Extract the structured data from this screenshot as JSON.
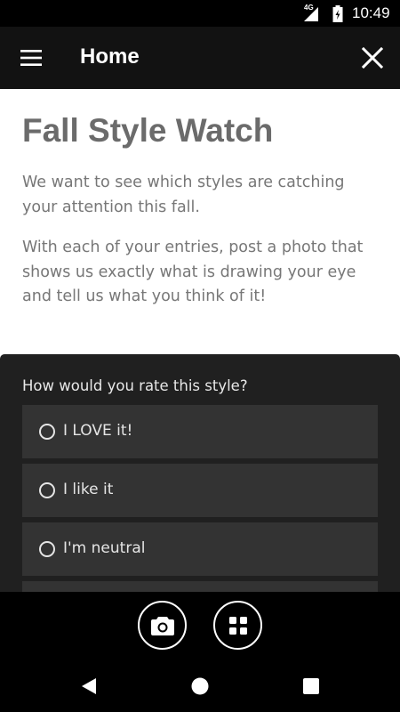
{
  "status_bar": {
    "network": "4G",
    "time": "10:49",
    "icons": [
      "signal-icon",
      "battery-icon"
    ]
  },
  "app_bar": {
    "title": "Home",
    "menu_icon": "hamburger-menu-icon",
    "close_icon": "close-icon"
  },
  "content": {
    "heading": "Fall Style Watch",
    "paragraph1": "We want to see which styles are catching your attention this fall.",
    "paragraph2": "With each of your entries, post a photo that shows us exactly what is drawing your eye and tell us what you think of it!"
  },
  "survey": {
    "question": "How would you rate this style?",
    "options": [
      {
        "label": "I LOVE it!"
      },
      {
        "label": "I like it"
      },
      {
        "label": "I'm neutral"
      },
      {
        "label": ""
      }
    ]
  },
  "bottom_bar": {
    "buttons": [
      "camera-icon",
      "grid-icon"
    ]
  },
  "nav_bar": {
    "buttons": [
      "back-icon",
      "home-icon",
      "recents-icon"
    ]
  },
  "colors": {
    "app_bar": "#121212",
    "survey_panel": "#202020",
    "option_bg": "#333333",
    "heading_text": "#6b6b6b"
  }
}
